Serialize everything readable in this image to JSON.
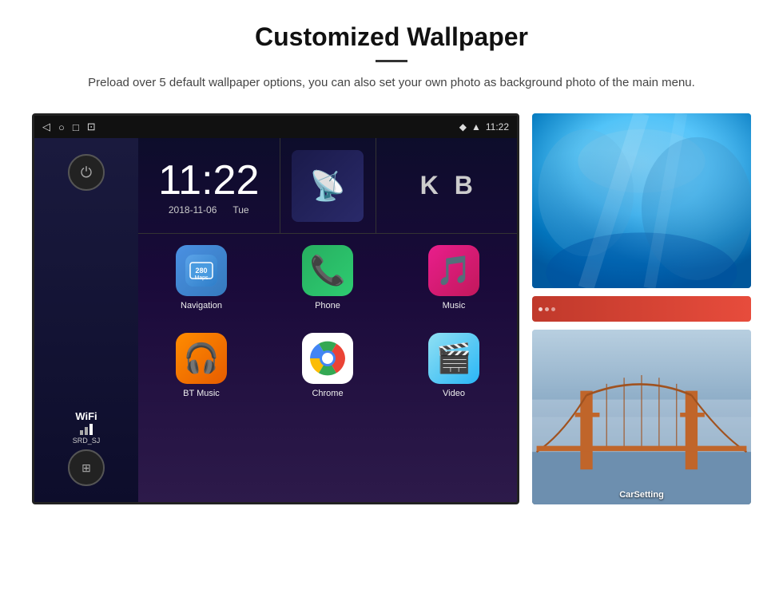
{
  "header": {
    "title": "Customized Wallpaper",
    "description": "Preload over 5 default wallpaper options, you can also set your own photo as background photo of the main menu."
  },
  "statusBar": {
    "time": "11:22",
    "icons": [
      "back",
      "home",
      "square",
      "image"
    ]
  },
  "clock": {
    "time": "11:22",
    "date": "2018-11-06",
    "day": "Tue"
  },
  "wifi": {
    "label": "WiFi",
    "ssid": "SRD_SJ"
  },
  "apps": [
    {
      "name": "Navigation",
      "icon": "nav"
    },
    {
      "name": "Phone",
      "icon": "phone"
    },
    {
      "name": "Music",
      "icon": "music"
    },
    {
      "name": "BT Music",
      "icon": "bt"
    },
    {
      "name": "Chrome",
      "icon": "chrome"
    },
    {
      "name": "Video",
      "icon": "video"
    }
  ],
  "wallpapers": [
    {
      "name": "ice-cave",
      "label": ""
    },
    {
      "name": "golden-gate",
      "label": "CarSetting"
    }
  ],
  "shortcuts": [
    "K",
    "B"
  ]
}
